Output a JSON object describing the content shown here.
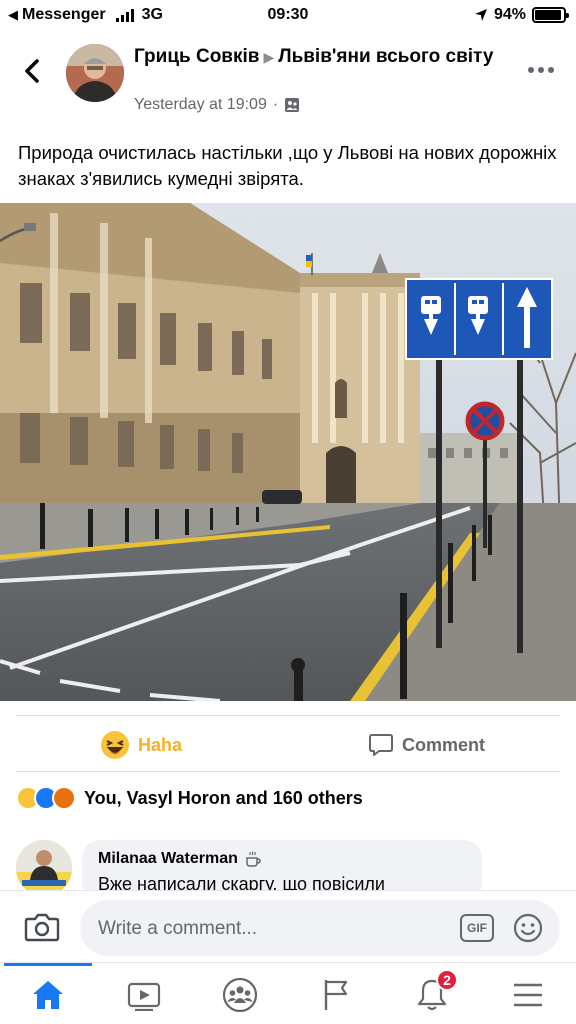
{
  "status_bar": {
    "carrier": "Messenger",
    "network": "3G",
    "time": "09:30",
    "battery": "94%",
    "battery_level": 0.94
  },
  "post": {
    "author": "Гриць Совків",
    "group": "Львів'яни всього світу",
    "timestamp": "Yesterday at 19:09",
    "separator": "·",
    "privacy_icon": "group-members-icon",
    "text": "Природа очистилась настільки ,що у Львові на нових дорожніх знаках з'явились кумедні звірята."
  },
  "actions": {
    "haha_label": "Haha",
    "comment_label": "Comment"
  },
  "reactions": {
    "icons": [
      "haha-icon",
      "like-icon",
      "angry-icon"
    ],
    "summary": "You, Vasyl Horon and 160 others"
  },
  "comment": {
    "author": "Milanaa Waterman",
    "author_icon": "coffee-icon",
    "text": "Вже написали скаргу, що повісили"
  },
  "composer": {
    "placeholder": "Write a comment...",
    "gif_label": "GIF"
  },
  "nav": {
    "items": [
      "home-icon",
      "watch-icon",
      "groups-icon",
      "pages-icon",
      "notifications-icon",
      "menu-icon"
    ],
    "notifications_badge": "2"
  },
  "colors": {
    "accent": "#1877f2",
    "haha": "#f7b125",
    "badge": "#e41e3f",
    "secondary_text": "#65676b"
  }
}
